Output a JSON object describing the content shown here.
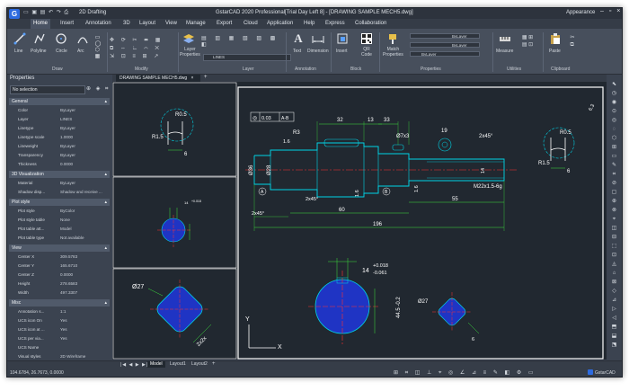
{
  "window": {
    "title": "GstarCAD 2020 Professional[Trial Day Left 8] - [DRAWING SAMPLE MECH5.dwg]",
    "workspace": "2D Drafting",
    "appearance": "Appearance"
  },
  "menu": {
    "tabs": [
      "Home",
      "Insert",
      "Annotation",
      "3D",
      "Layout",
      "View",
      "Manage",
      "Export",
      "Cloud",
      "Application",
      "Help",
      "Express",
      "Collaboration"
    ]
  },
  "ribbon": {
    "draw": {
      "group": "Draw",
      "tools": [
        "Line",
        "Polyline",
        "Circle",
        "Arc"
      ]
    },
    "modify": {
      "group": "Modify"
    },
    "layer": {
      "group": "Layer",
      "layer_properties": "Layer\nProperties",
      "current_layer": "LINES"
    },
    "annotation": {
      "group": "Annotation",
      "text": "Text",
      "dimension": "Dimension"
    },
    "block": {
      "group": "Block",
      "insert": "Insert",
      "qr_code": "QR\nCode"
    },
    "properties": {
      "group": "Properties",
      "match": "Match\nProperties",
      "color": "ByLayer",
      "linetype": "ByLayer",
      "lineweight": "ByLayer"
    },
    "utilities": {
      "group": "Utilities",
      "measure": "Measure"
    },
    "clipboard": {
      "group": "Clipboard",
      "paste": "Paste"
    }
  },
  "properties": {
    "title": "Properties",
    "selection": "No selection",
    "sections": {
      "general": {
        "title": "General",
        "rows": [
          [
            "Color",
            "ByLayer"
          ],
          [
            "Layer",
            "LINES"
          ],
          [
            "Linetype",
            "ByLayer"
          ],
          [
            "Linetype scale",
            "1.0000"
          ],
          [
            "Lineweight",
            "ByLayer"
          ],
          [
            "Transparency",
            "ByLayer"
          ],
          [
            "Thickness",
            "0.0000"
          ]
        ]
      },
      "viz": {
        "title": "3D Visualization",
        "rows": [
          [
            "Material",
            "ByLayer"
          ],
          [
            "Shadow disp...",
            "Shadow and receive ..."
          ]
        ]
      },
      "plot": {
        "title": "Plot style",
        "rows": [
          [
            "Plot style",
            "ByColor"
          ],
          [
            "Plot style table",
            "None"
          ],
          [
            "Plot table att...",
            "Model"
          ],
          [
            "Plot table type",
            "Not available"
          ]
        ]
      },
      "view": {
        "title": "View",
        "rows": [
          [
            "Center X",
            "309.5783"
          ],
          [
            "Center Y",
            "165.6710"
          ],
          [
            "Center Z",
            "0.0000"
          ],
          [
            "Height",
            "278.6583"
          ],
          [
            "Width",
            "497.3307"
          ]
        ]
      },
      "misc": {
        "title": "Misc",
        "rows": [
          [
            "Annotation s...",
            "1:1"
          ],
          [
            "UCS icon On",
            "Yes"
          ],
          [
            "UCS icon at ...",
            "Yes"
          ],
          [
            "UCS per via...",
            "Yes"
          ],
          [
            "UCS Name",
            ""
          ],
          [
            "Visual styles",
            "2D Wireframe"
          ]
        ]
      }
    }
  },
  "doc_tab": "DRAWING SAMPLE MECH5.dwg",
  "layout_tabs": [
    "Model",
    "Layout1",
    "Layout2"
  ],
  "status": {
    "coords": "104.6784, 26.7673, 0.0000",
    "brand": "GstarCAD"
  },
  "drawing": {
    "dims": {
      "tol": "0.03",
      "ref": "A-B",
      "d32": "32",
      "d13": "13",
      "d33": "33",
      "d19": "19",
      "chamfer": "2x45°",
      "r3": "R3",
      "d16": "1.6",
      "d36": "Ø36",
      "d28": "Ø28",
      "d7": "Ø7x3",
      "d14": "14",
      "thread": "M22x1.5-6g",
      "d60": "60",
      "d55": "55",
      "d196": "196",
      "d2x45b": "2x45°",
      "d2x45c": "2x45°",
      "r05a": "R0.5",
      "r15a": "R1.5",
      "d6a": "6",
      "r05b": "R0.5",
      "r15b": "R1.5",
      "d6b": "6",
      "d63": "6.3",
      "dA": "A",
      "dB": "B",
      "d27": "Ø27",
      "d2x2": "2x2x",
      "d27b": "Ø27",
      "d14b": "14",
      "tol1": "+0.018",
      "tol2": "-0.061",
      "d445": "44.5 -0.2",
      "d14s": "14",
      "tolsm": "+0.018"
    },
    "ucs": {
      "x": "X",
      "y": "Y"
    }
  },
  "colors": {
    "canvas": "#212830",
    "accent": "#2d6be0",
    "cyan": "#00d4e6",
    "green": "#3ce03c",
    "yellow": "#e8e84a",
    "red": "#ff3030",
    "blue": "#1f34c4",
    "white": "#ffffff"
  }
}
